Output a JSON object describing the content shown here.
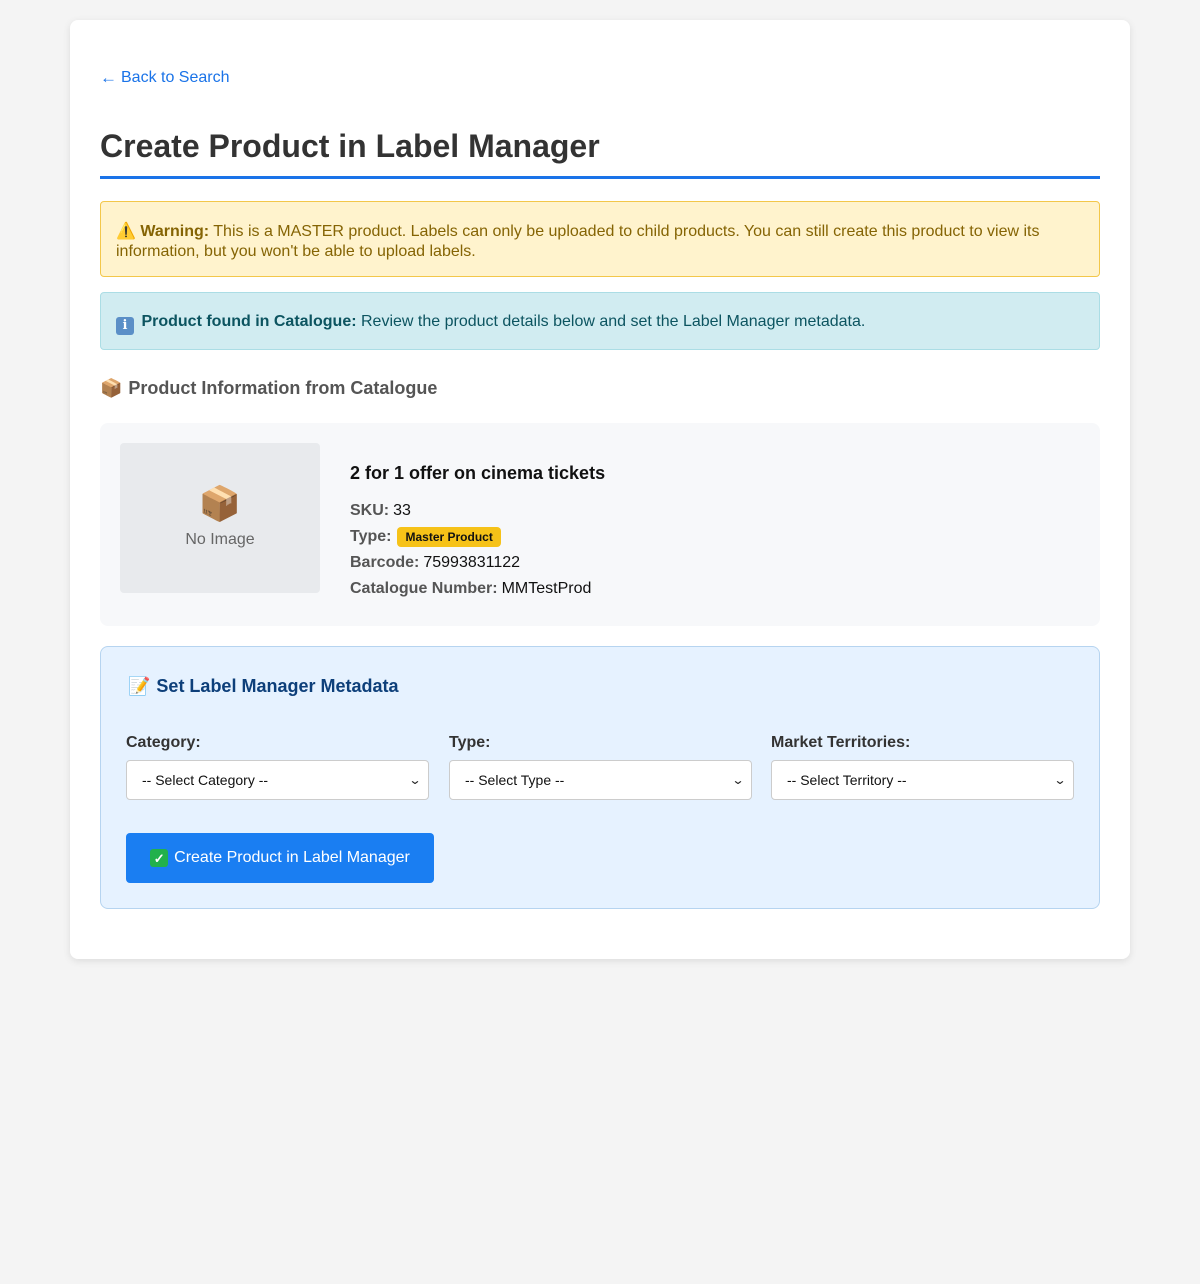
{
  "nav": {
    "back_label": "Back to Search",
    "back_arrow": "←"
  },
  "page": {
    "title": "Create Product in Label Manager"
  },
  "warning": {
    "icon": "⚠️",
    "label": "Warning:",
    "text": " This is a MASTER product. Labels can only be uploaded to child products. You can still create this product to view its information, but you won't be able to upload labels."
  },
  "info": {
    "icon": "i",
    "label": "Product found in Catalogue:",
    "text": " Review the product details below and set the Label Manager metadata."
  },
  "product_section": {
    "icon": "📦",
    "heading": "Product Information from Catalogue"
  },
  "product": {
    "image_icon": "📦",
    "image_placeholder": "No Image",
    "name": "2 for 1 offer on cinema tickets",
    "sku_label": "SKU:",
    "sku": "33",
    "type_label": "Type:",
    "type_badge": "Master Product",
    "barcode_label": "Barcode:",
    "barcode": "75993831122",
    "catalogue_label": "Catalogue Number:",
    "catalogue_number": "MMTestProd"
  },
  "metadata": {
    "icon": "📝",
    "heading": "Set Label Manager Metadata",
    "category_label": "Category:",
    "category_value": "-- Select Category --",
    "type_label": "Type:",
    "type_value": "-- Select Type --",
    "territories_label": "Market Territories:",
    "territories_value": "-- Select Territory --",
    "create_check": "✓",
    "create_button": "Create Product in Label Manager"
  },
  "colors": {
    "accent": "#1a73e8",
    "button": "#1a7ef2",
    "warning_bg": "#fff3cd",
    "info_bg": "#d1ecf1",
    "badge": "#f6c218"
  }
}
